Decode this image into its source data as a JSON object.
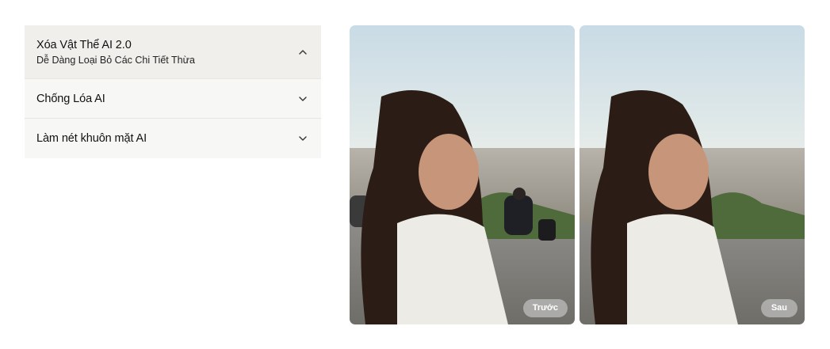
{
  "accordion": {
    "items": [
      {
        "title": "Xóa Vật Thể AI 2.0",
        "subtitle": "Dễ Dàng Loại Bỏ Các Chi Tiết Thừa",
        "expanded": true,
        "icon": "chevron-up-icon"
      },
      {
        "title": "Chống Lóa AI",
        "expanded": false,
        "icon": "chevron-down-icon"
      },
      {
        "title": "Làm nét khuôn mặt AI",
        "expanded": false,
        "icon": "chevron-down-icon"
      }
    ]
  },
  "comparison": {
    "before_label": "Trước",
    "after_label": "Sau"
  }
}
